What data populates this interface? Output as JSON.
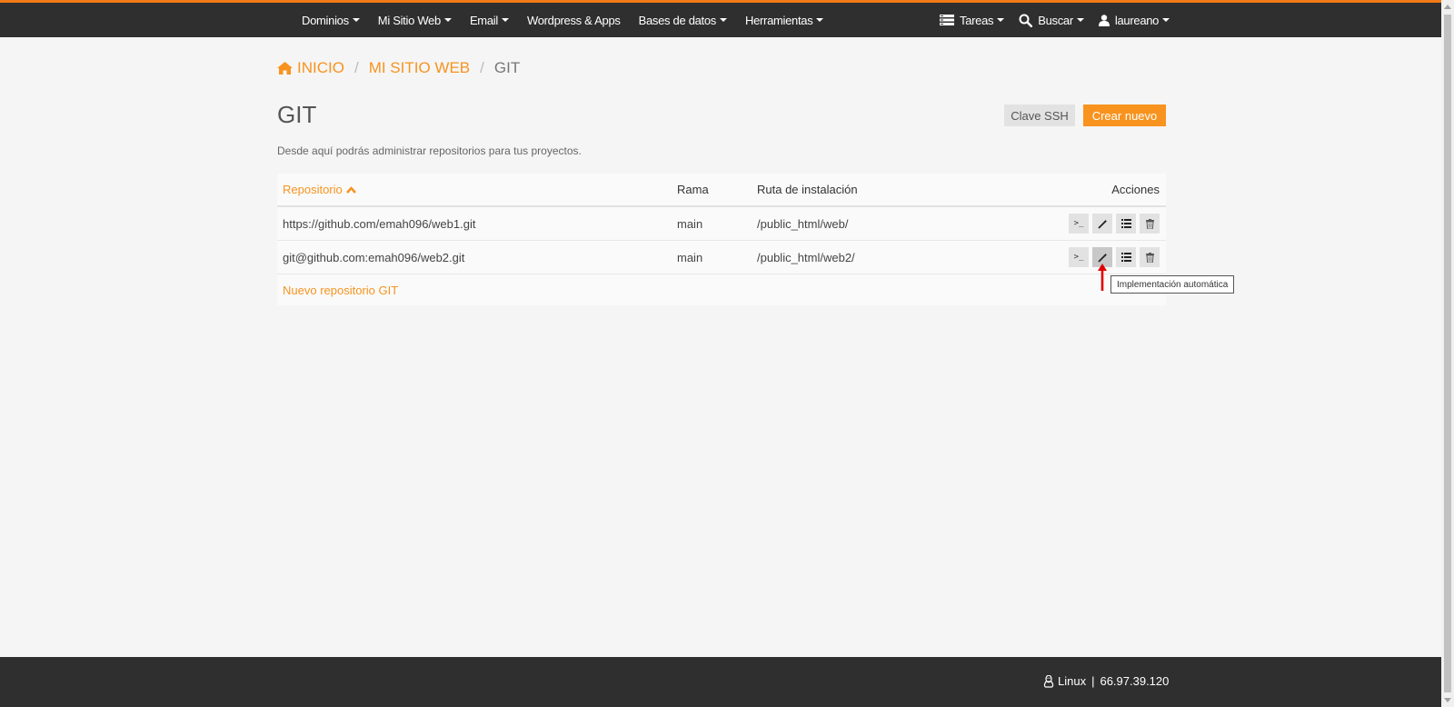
{
  "topnav": {
    "left": [
      {
        "label": "Dominios"
      },
      {
        "label": "Mi Sitio Web"
      },
      {
        "label": "Email"
      },
      {
        "label": "Wordpress & Apps"
      },
      {
        "label": "Bases de datos"
      },
      {
        "label": "Herramientas"
      }
    ],
    "tasks_label": "Tareas",
    "search_label": "Buscar",
    "user_label": "laureano"
  },
  "breadcrumb": {
    "home": "INICIO",
    "section": "MI SITIO WEB",
    "current": "GIT"
  },
  "page": {
    "title": "GIT",
    "description": "Desde aquí podrás administrar repositorios para tus proyectos.",
    "ssh_button": "Clave SSH",
    "new_button": "Crear nuevo"
  },
  "table": {
    "headers": {
      "repo": "Repositorio",
      "branch": "Rama",
      "path": "Ruta de instalación",
      "actions": "Acciones"
    },
    "rows": [
      {
        "repo": "https://github.com/emah096/web1.git",
        "branch": "main",
        "path": "/public_html/web/"
      },
      {
        "repo": "git@github.com:emah096/web2.git",
        "branch": "main",
        "path": "/public_html/web2/"
      }
    ],
    "new_repo_link": "Nuevo repositorio GIT",
    "terminal_glyph": ">_"
  },
  "tooltip": "Implementación automática",
  "footer": {
    "os": "Linux",
    "separator": "|",
    "ip": "66.97.39.120"
  },
  "colors": {
    "accent": "#f7931e",
    "topbar": "#2f2f2f",
    "topbar_border": "#f07b16",
    "arrow": "#e00000"
  }
}
